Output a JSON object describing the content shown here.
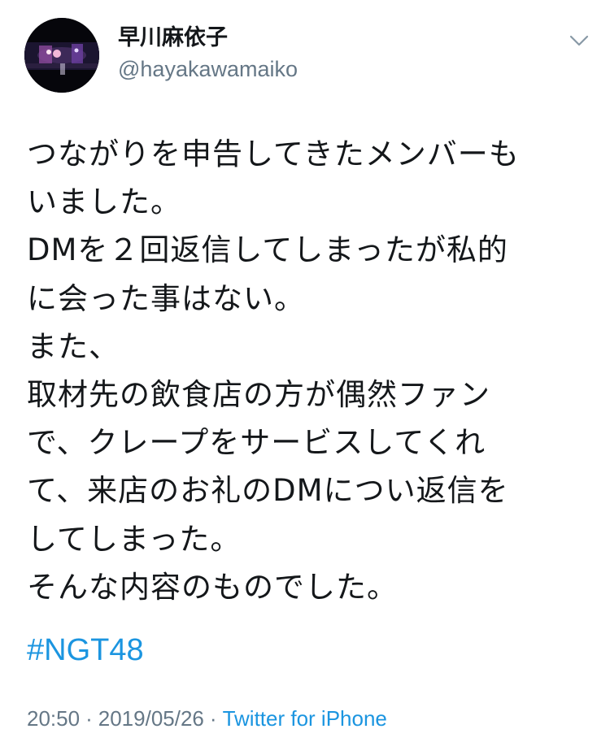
{
  "tweet": {
    "author": {
      "display_name": "早川麻依子",
      "handle": "@hayakawamaiko",
      "avatar_icon": "profile-photo-stage"
    },
    "menu_icon": "chevron-down-icon",
    "body_lines": [
      "つながりを申告してきたメンバーも",
      "いました。",
      "DMを２回返信してしまったが私的",
      "に会った事はない。",
      "また、",
      "取材先の飲食店の方が偶然ファン",
      "で、クレープをサービスしてくれ",
      "て、来店のお礼のDMについ返信を",
      "してしまった。",
      "そんな内容のものでした。"
    ],
    "hashtag": "#NGT48",
    "time": "20:50",
    "date": "2019/05/26",
    "separator": "·",
    "source": "Twitter for iPhone"
  },
  "colors": {
    "text": "#14171a",
    "secondary": "#657786",
    "link": "#1b95e0",
    "background": "#ffffff"
  }
}
